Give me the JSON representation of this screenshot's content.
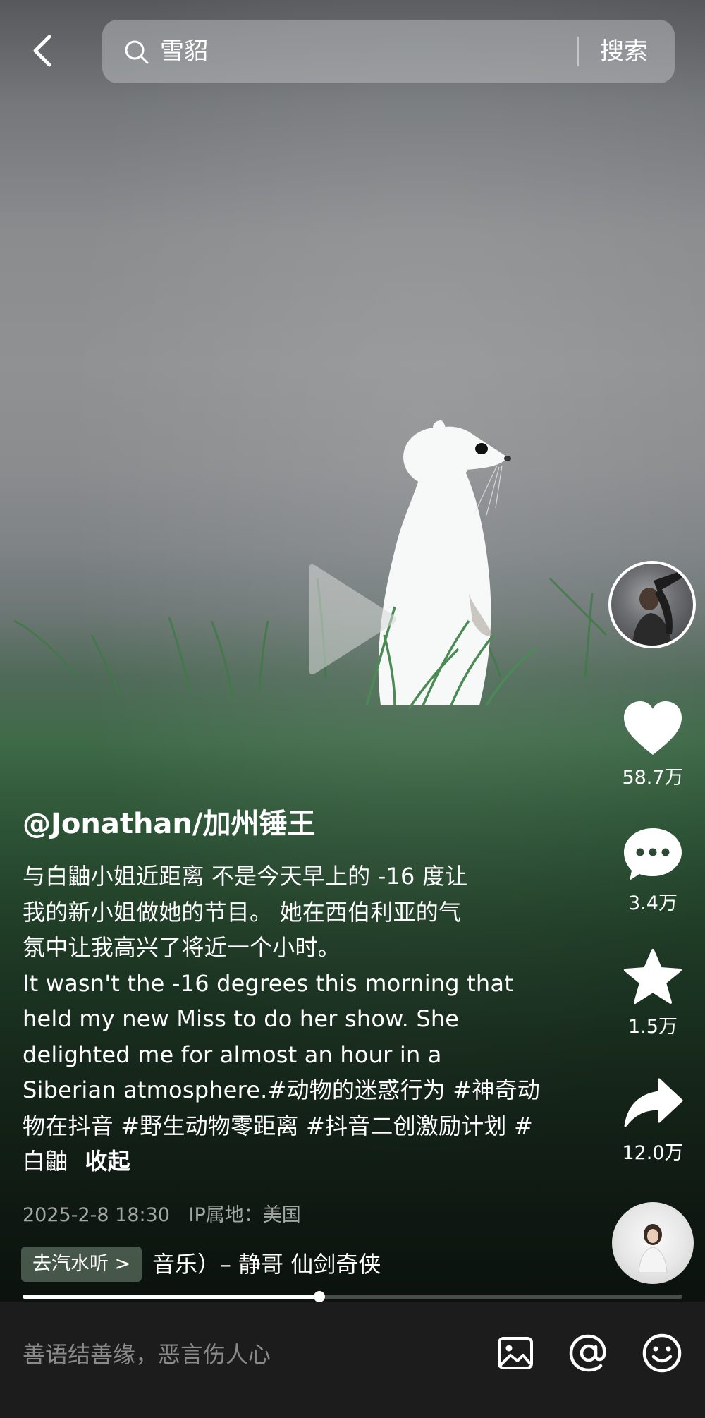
{
  "search": {
    "query": "雪貂",
    "button_label": "搜索"
  },
  "video": {
    "progress_percent": 45,
    "accent_colors": {
      "grass": "#2f5e3a",
      "fog": "#8a8c8e"
    }
  },
  "actions": {
    "likes": "58.7万",
    "comments": "3.4万",
    "favorites": "1.5万",
    "shares": "12.0万"
  },
  "post": {
    "author": "@Jonathan/加州锤王",
    "description_lines": [
      "与白鼬小姐近距离 不是今天早上的 -16 度让",
      "我的新小姐做她的节目。 她在西伯利亚的气",
      "氛中让我高兴了将近一个小时。",
      "It wasn't the -16 degrees this morning that",
      "held my new Miss to do her show. She",
      "delighted me for almost an hour in a"
    ],
    "description_tail_prefix": "Siberian atmosphere.",
    "hashtags": [
      "#动物的迷惑行为",
      "#神奇动物在抖音",
      "#野生动物零距离",
      "#抖音二创激励计划",
      "#白鼬"
    ],
    "collapse_label": "收起",
    "date": "2025-2-8 18:30",
    "ip_location": "IP属地：美国"
  },
  "music": {
    "soda_button_label": "去汽水听 >",
    "title": "音乐）– 静哥    仙剑奇侠"
  },
  "comment_bar": {
    "placeholder": "善语结善缘，恶言伤人心"
  },
  "icons": [
    "back-arrow-icon",
    "search-icon",
    "play-icon",
    "heart-icon",
    "comment-bubble-icon",
    "star-icon",
    "share-arrow-icon",
    "image-icon",
    "at-icon",
    "emoji-icon"
  ]
}
